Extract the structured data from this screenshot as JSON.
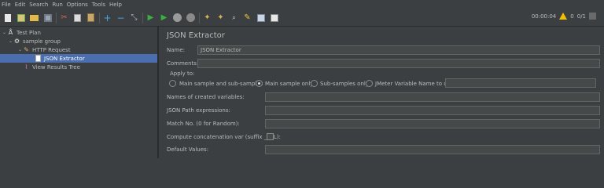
{
  "menu": [
    "File",
    "Edit",
    "Search",
    "Run",
    "Options",
    "Tools",
    "Help"
  ],
  "toolbar": {
    "icons": [
      "new-icon",
      "templates-icon",
      "open-icon",
      "save-icon",
      "cut-icon",
      "copy-icon",
      "paste-icon",
      "expand-icon",
      "collapse-icon",
      "toggle-icon",
      "start-icon",
      "start-no-timers-icon",
      "stop-icon",
      "shutdown-icon",
      "clear-icon",
      "clear-all-icon",
      "search-icon",
      "reset-search-icon",
      "function-helper-icon",
      "help-icon"
    ],
    "timer": "00:00:04",
    "warning_count": "0",
    "threads": "0/1"
  },
  "tree": {
    "items": [
      {
        "label": "Test Plan",
        "icon": "test-plan-icon"
      },
      {
        "label": "sample group",
        "icon": "gear-icon"
      },
      {
        "label": "HTTP Request",
        "icon": "pencil-icon"
      },
      {
        "label": "JSON Extractor",
        "icon": "document-icon"
      },
      {
        "label": "View Results Tree",
        "icon": "graph-icon"
      }
    ]
  },
  "editor": {
    "title": "JSON Extractor",
    "name_label": "Name:",
    "name_value": "JSON Extractor",
    "comments_label": "Comments:",
    "comments_value": "",
    "apply_to_label": "Apply to:",
    "apply_options": [
      "Main sample and sub-samples",
      "Main sample only",
      "Sub-samples only",
      "JMeter Variable Name to use"
    ],
    "apply_selected": "Main sample only",
    "jmeter_var_value": "",
    "names_label": "Names of created variables:",
    "names_value": "",
    "jsonpath_label": "JSON Path expressions:",
    "jsonpath_value": "",
    "matchno_label": "Match No. (0 for Random):",
    "matchno_value": "",
    "concat_label": "Compute concatenation var (suffix _ALL):",
    "concat_checked": false,
    "default_label": "Default Values:",
    "default_value": ""
  },
  "colors": {
    "background": "#3c3f41",
    "selection": "#4b6eaf",
    "field": "#45494a",
    "text": "#bbbbbb"
  }
}
